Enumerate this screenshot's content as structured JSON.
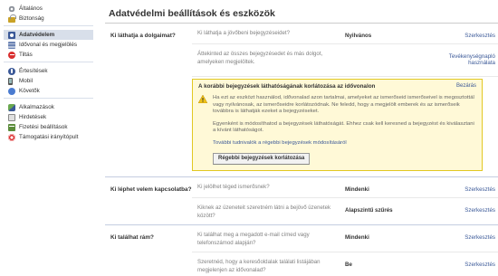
{
  "sidebar": {
    "group1": [
      {
        "icon": "gear-icon",
        "label": "Általános"
      },
      {
        "icon": "lock-icon",
        "label": "Biztonság"
      }
    ],
    "group2": [
      {
        "icon": "privacy-icon",
        "label": "Adatvédelem",
        "active": true
      },
      {
        "icon": "timeline-icon",
        "label": "Idővonal és megjelölés"
      },
      {
        "icon": "block-icon",
        "label": "Tiltás"
      }
    ],
    "group3": [
      {
        "icon": "notification-icon",
        "label": "Értesítések"
      },
      {
        "icon": "mobile-icon",
        "label": "Mobil"
      },
      {
        "icon": "followers-icon",
        "label": "Követők"
      }
    ],
    "group4": [
      {
        "icon": "apps-icon",
        "label": "Alkalmazások"
      },
      {
        "icon": "ads-icon",
        "label": "Hirdetések"
      },
      {
        "icon": "payments-icon",
        "label": "Fizetési beállítások"
      },
      {
        "icon": "support-icon",
        "label": "Támogatási irányítópult"
      }
    ]
  },
  "main": {
    "title": "Adatvédelmi beállítások és eszközök",
    "sections": {
      "s1": {
        "label": "Ki láthatja a dolgaimat?",
        "rows": [
          {
            "question": "Ki láthatja a jövőbeni bejegyzéseidet?",
            "value": "Nyilvános",
            "action": "Szerkesztés"
          },
          {
            "question": "Áttekinted az összes bejegyzésedet és más dolgot, amelyeken megjelöltek.",
            "value": "",
            "action": "Tevékenységnapló használata"
          }
        ],
        "notice": {
          "title": "A korábbi bejegyzések láthatóságának korlátozása az idővonalon",
          "close": "Bezárás",
          "p1": "Ha ezt az eszközt használod, idővonalad azon tartalmai, amelyeket az ismerőseid ismerőseivel is megosztottál vagy nyilvánosak, az ismerőseidre korlátozódnak. Ne feledd, hogy a megjelölt emberek és az ismerőseik továbbra is láthatják ezeket a bejegyzéseket.",
          "p2": "Egyenként is módosíthatod a bejegyzések láthatóságát. Ehhez csak kell keresned a bejegyzést és kiválasztani a kívánt láthatóságot.",
          "link": "További tudnivalók a régebbi bejegyzések módosításáról",
          "button": "Régebbi bejegyzések korlátozása"
        }
      },
      "s2": {
        "label": "Ki léphet velem kapcsolatba?",
        "rows": [
          {
            "question": "Ki jelölhet téged ismerősnek?",
            "value": "Mindenki",
            "action": "Szerkesztés"
          },
          {
            "question": "Kiknek az üzeneteit szeretném látni a bejövő üzenetek között?",
            "value": "Alapszintű szűrés",
            "action": "Szerkesztés"
          }
        ]
      },
      "s3": {
        "label": "Ki találhat rám?",
        "rows": [
          {
            "question": "Ki találhat meg a megadott e-mail címed vagy telefonszámod alapján?",
            "value": "Mindenki",
            "action": "Szerkesztés"
          },
          {
            "question": "Szeretnéd, hogy a keresőoldalak találati listájában megjelenjen az idővonalad?",
            "value": "Be",
            "action": "Szerkesztés"
          }
        ]
      }
    }
  },
  "colors": {
    "link": "#3b5998",
    "active_bg": "#d8dfea",
    "notice_bg": "#fff9d7",
    "notice_border": "#e2c822"
  }
}
